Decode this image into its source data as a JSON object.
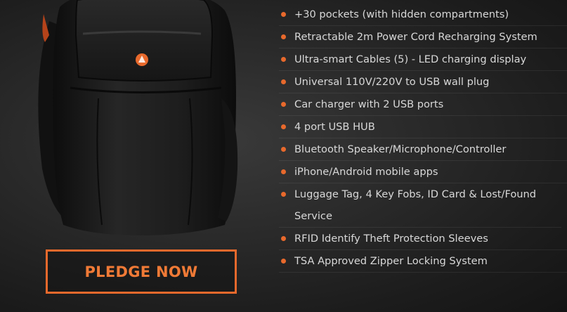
{
  "cta": {
    "label": "PLEDGE NOW"
  },
  "features": [
    "+30 pockets (with hidden compartments)",
    "Retractable 2m Power Cord Recharging System",
    "Ultra-smart Cables (5) - LED charging display",
    "Universal 110V/220V to USB wall plug",
    "Car charger with 2 USB ports",
    "4 port USB HUB",
    "Bluetooth Speaker/Microphone/Controller",
    "iPhone/Android mobile apps",
    "Luggage Tag, 4 Key Fobs, ID Card & Lost/Found Service",
    "RFID Identify Theft Protection Sleeves",
    "TSA Approved Zipper Locking System"
  ],
  "colors": {
    "accent": "#e8692c",
    "background": "#2a2a2a",
    "text": "#d8d8d8"
  },
  "icons": {
    "bullet": "orange-dot-icon",
    "logo": "brand-logo-icon"
  }
}
